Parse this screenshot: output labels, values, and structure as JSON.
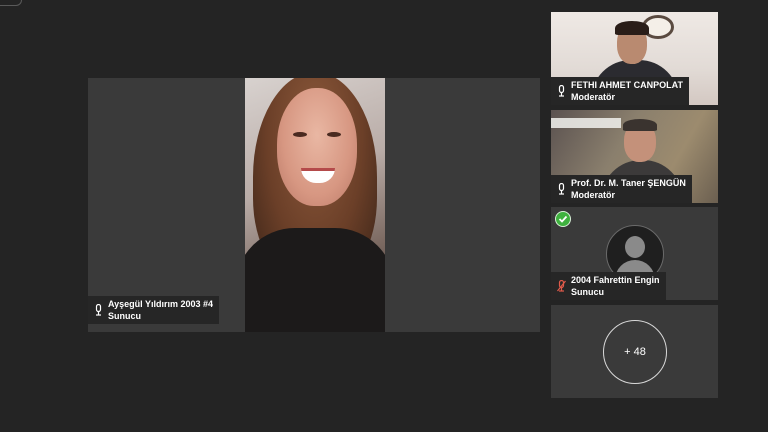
{
  "main": {
    "presenter_name": "Ayşegül Yıldırım 2003 #4",
    "presenter_role": "Sunucu"
  },
  "participants": [
    {
      "name": "FETHI AHMET CANPOLAT",
      "role": "Moderatör",
      "mic": "on"
    },
    {
      "name": "Prof. Dr. M. Taner ŞENGÜN",
      "role": "Moderatör",
      "mic": "on"
    },
    {
      "name": "2004 Fahrettin Engin",
      "role": "Sunucu",
      "mic": "muted"
    }
  ],
  "more": {
    "label": "+ 48"
  },
  "colors": {
    "background": "#242424",
    "tile": "#3a3a3a",
    "muted_mic": "#e05a4a",
    "status_check": "#3fb23f"
  },
  "icons": {
    "mic": "mic-icon",
    "mic_muted": "mic-muted-icon",
    "status": "check-icon",
    "avatar": "default-avatar-icon"
  }
}
